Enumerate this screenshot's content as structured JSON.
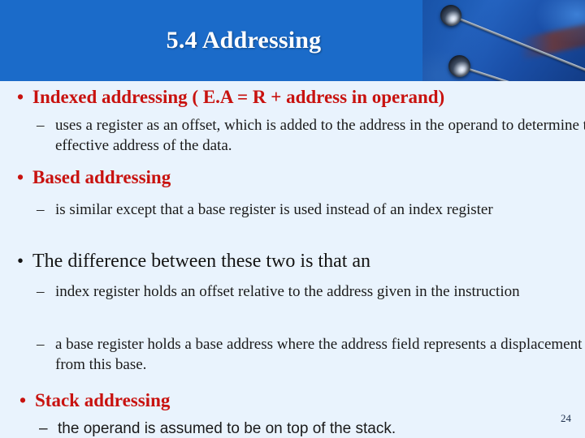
{
  "slide": {
    "title": "5.4 Addressing",
    "page_number": "24",
    "colors": {
      "banner_blue": "#1b6bc9",
      "body_background": "#e9f3fd",
      "heading_red": "#c8120f",
      "title_white": "#ffffff",
      "body_black": "#1a1a1a"
    }
  },
  "bullets": {
    "bullet_glyph": "•",
    "dash_glyph": "–",
    "indexed": {
      "heading": "Indexed addressing  ( E.A = R + address in operand)",
      "sub": "uses a register as an offset, which is added to the address in the operand to determine the effective address of the data."
    },
    "based": {
      "heading": "Based addressing",
      "sub": "is similar except that a base register is used instead of an index register"
    },
    "difference": {
      "heading": "The difference between these two is that an",
      "sub_1": "index register holds an offset relative to the address given in the instruction",
      "sub_2": "a base register holds a base address where the address field represents a displacement from this base."
    },
    "stack": {
      "heading": "Stack addressing",
      "sub": "the operand is assumed to be on top of the stack."
    }
  }
}
